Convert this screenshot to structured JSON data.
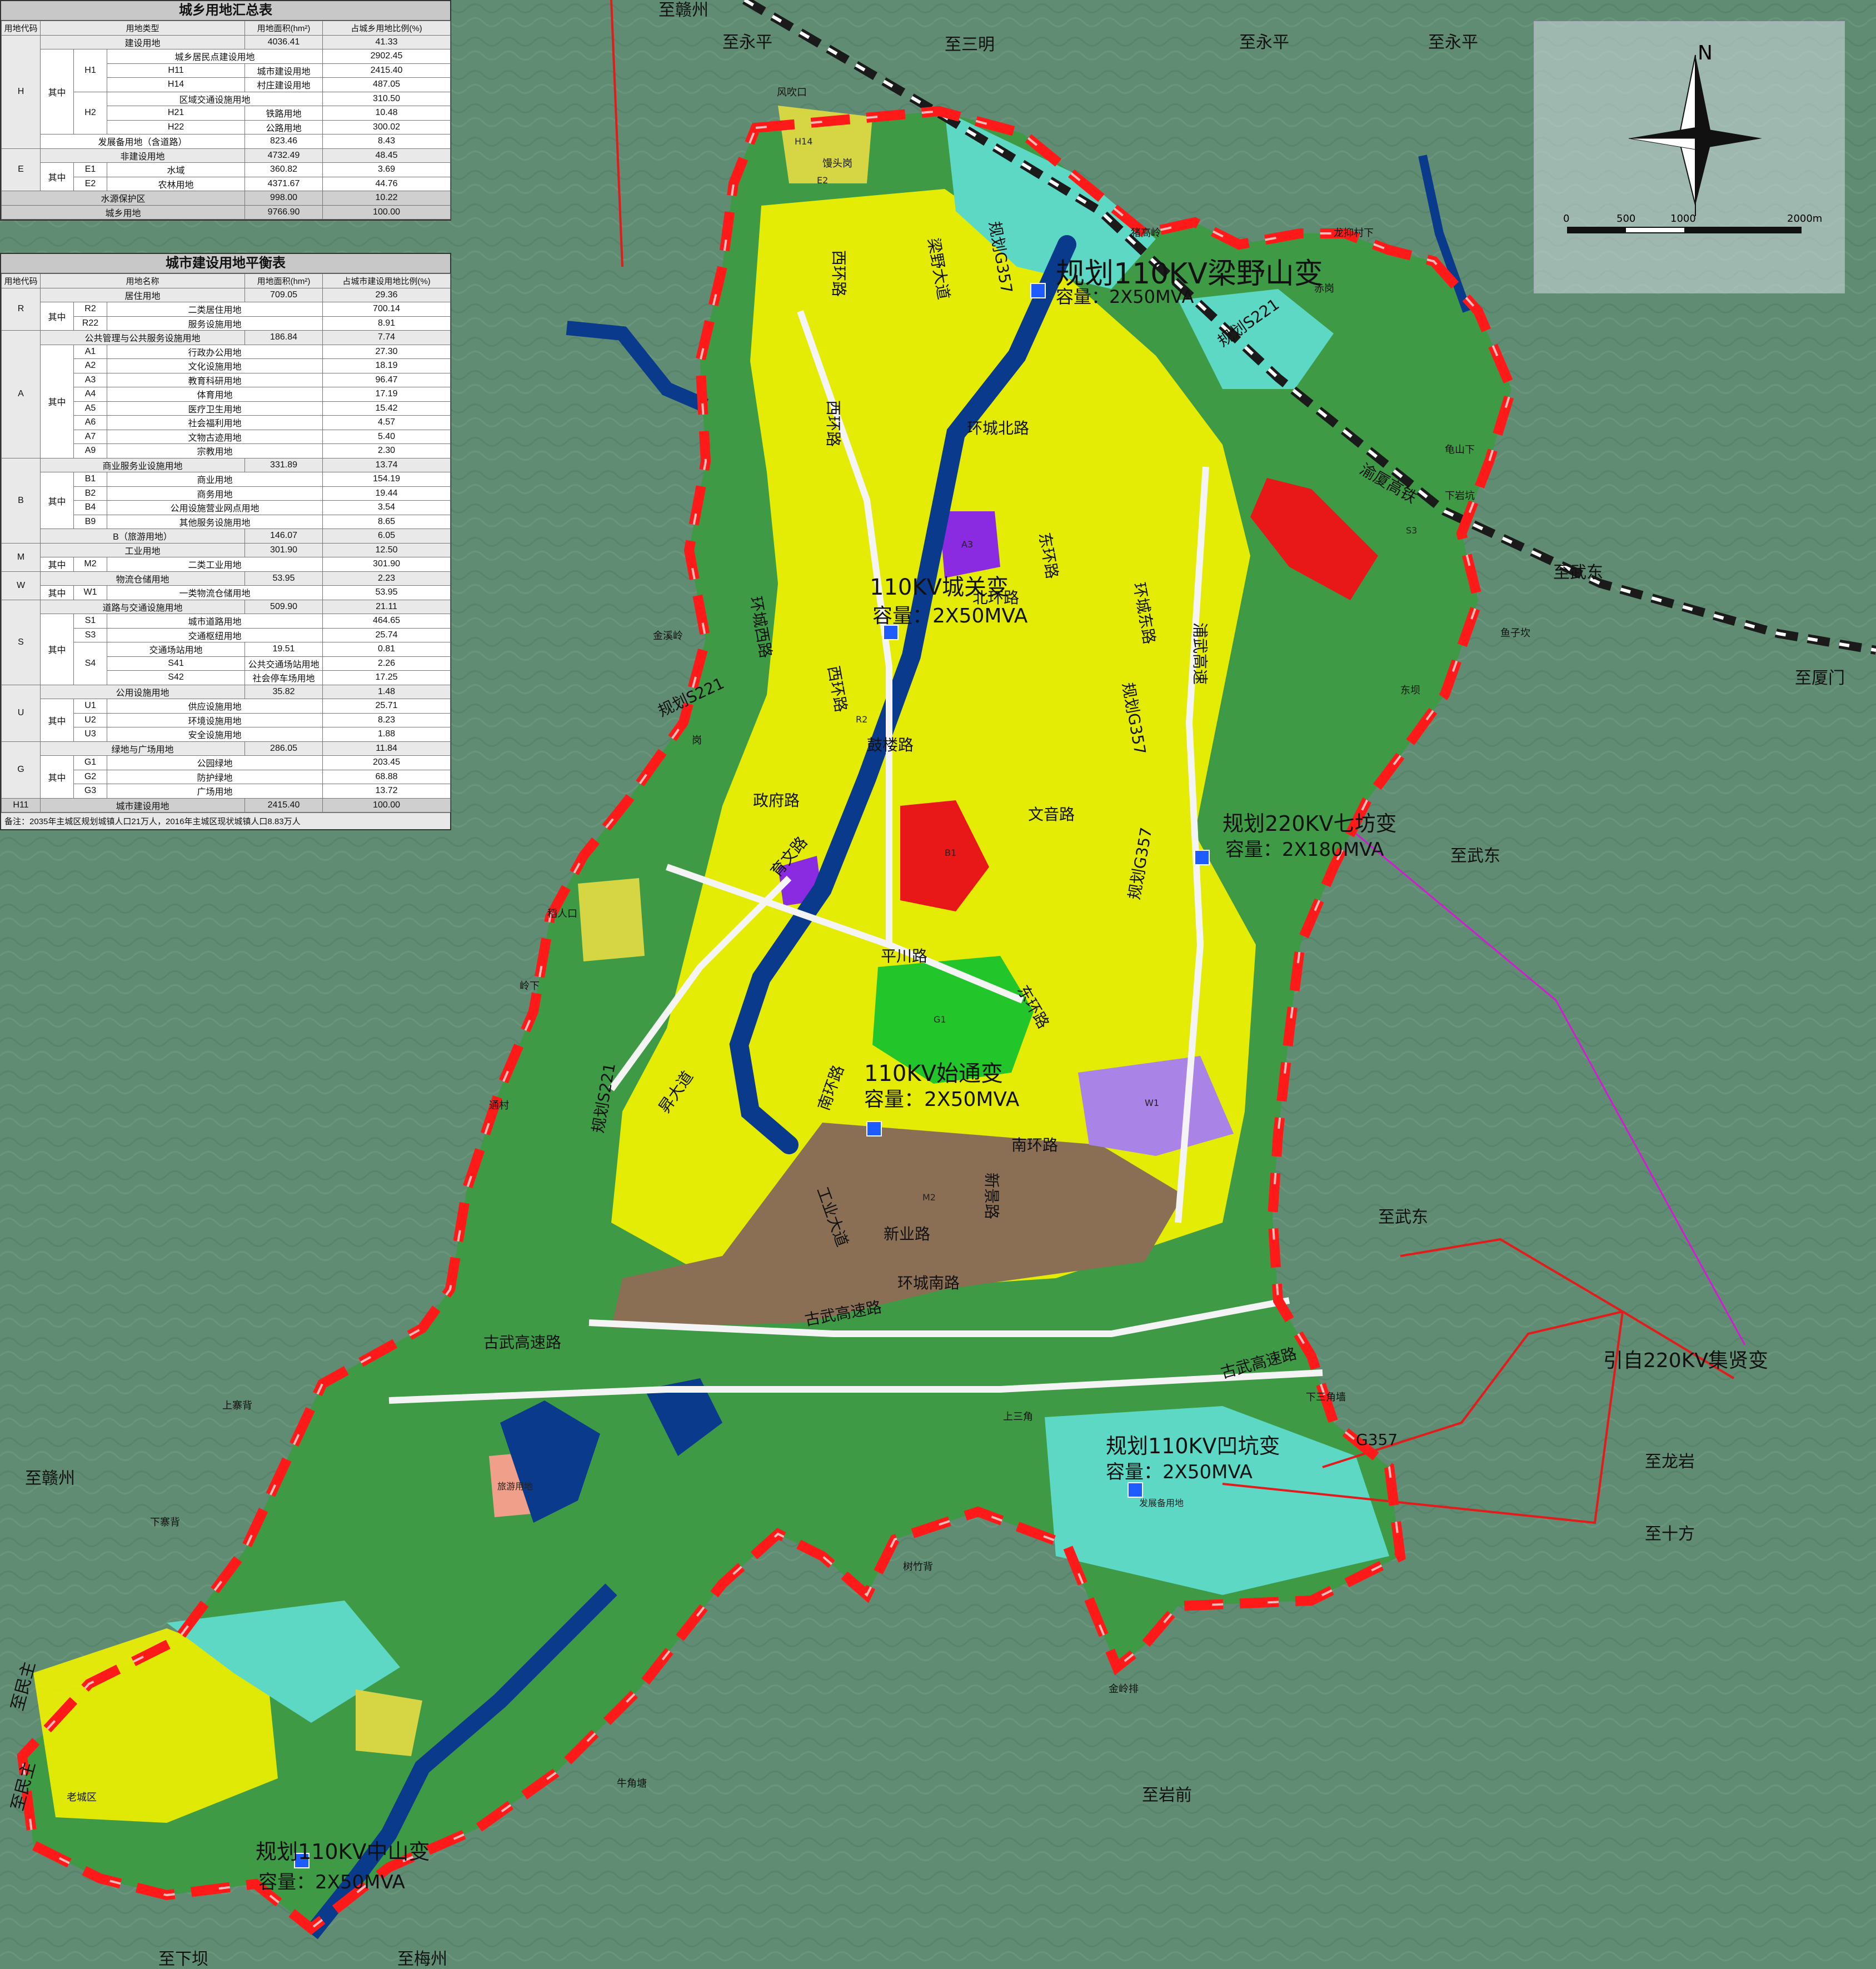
{
  "colors": {
    "mountain": "#5f8c72",
    "green_space": "#3e9a44",
    "park": "#22c52a",
    "residential": "#f2f200",
    "village": "#d6d644",
    "industrial": "#8a6f55",
    "commercial": "#e81818",
    "public": "#8a2be2",
    "reserve": "#5cd8c4",
    "logistics": "#a983e6",
    "tourism": "#f0a08a",
    "water": "#0a3a8c",
    "boundary": "#ff1a1a",
    "rail": "#1a1a1a"
  },
  "table1": {
    "title": "城乡用地汇总表",
    "headers": [
      "用地代码",
      "用地类型",
      "用地面积(hm²)",
      "占城乡用地比例(%)"
    ],
    "rows": [
      [
        "",
        "",
        "建设用地",
        "4036.41",
        "41.33"
      ],
      [
        "H1",
        "",
        "城乡居民点建设用地",
        "2902.45",
        "29.72"
      ],
      [
        "H11",
        "",
        "城市建设用地",
        "2415.40",
        "24.73"
      ],
      [
        "H14",
        "",
        "村庄建设用地",
        "487.05",
        "4.99"
      ],
      [
        "H2",
        "",
        "区域交通设施用地",
        "310.50",
        "3.18"
      ],
      [
        "H21",
        "",
        "铁路用地",
        "10.48",
        "0.11"
      ],
      [
        "H22",
        "",
        "公路用地",
        "300.02",
        "3.07"
      ],
      [
        "",
        "",
        "发展备用地（含道路）",
        "823.46",
        "8.43"
      ],
      [
        "",
        "",
        "非建设用地",
        "4732.49",
        "48.45"
      ],
      [
        "E1",
        "",
        "水域",
        "360.82",
        "3.69"
      ],
      [
        "E2",
        "",
        "农林用地",
        "4371.67",
        "44.76"
      ],
      [
        "",
        "",
        "水源保护区",
        "998.00",
        "10.22"
      ],
      [
        "",
        "",
        "城乡用地",
        "9766.90",
        "100.00"
      ]
    ],
    "group_H": "H",
    "group_E": "E",
    "qizhong": "其中"
  },
  "table2": {
    "title": "城市建设用地平衡表",
    "headers": [
      "用地代码",
      "用地名称",
      "用地面积(hm²)",
      "占城市建设用地比例(%)"
    ],
    "rows": [
      [
        "",
        "居住用地",
        "709.05",
        "29.36"
      ],
      [
        "R2",
        "二类居住用地",
        "700.14",
        "28.99"
      ],
      [
        "R22",
        "服务设施用地",
        "8.91",
        "0.37"
      ],
      [
        "",
        "公共管理与公共服务设施用地",
        "186.84",
        "7.74"
      ],
      [
        "A1",
        "行政办公用地",
        "27.30",
        "1.13"
      ],
      [
        "A2",
        "文化设施用地",
        "18.19",
        "0.75"
      ],
      [
        "A3",
        "教育科研用地",
        "96.47",
        "3.99"
      ],
      [
        "A4",
        "体育用地",
        "17.19",
        "0.71"
      ],
      [
        "A5",
        "医疗卫生用地",
        "15.42",
        "0.64"
      ],
      [
        "A6",
        "社会福利用地",
        "4.57",
        "0.19"
      ],
      [
        "A7",
        "文物古迹用地",
        "5.40",
        "0.22"
      ],
      [
        "A9",
        "宗教用地",
        "2.30",
        "0.10"
      ],
      [
        "",
        "商业服务业设施用地",
        "331.89",
        "13.74"
      ],
      [
        "B1",
        "商业用地",
        "154.19",
        "6.38"
      ],
      [
        "B2",
        "商务用地",
        "19.44",
        "0.80"
      ],
      [
        "B4",
        "公用设施营业网点用地",
        "3.54",
        "0.15"
      ],
      [
        "B9",
        "其他服务设施用地",
        "8.65",
        "0.36"
      ],
      [
        "",
        "B（旅游用地）",
        "146.07",
        "6.05"
      ],
      [
        "",
        "工业用地",
        "301.90",
        "12.50"
      ],
      [
        "M2",
        "二类工业用地",
        "301.90",
        "12.50"
      ],
      [
        "",
        "物流仓储用地",
        "53.95",
        "2.23"
      ],
      [
        "W1",
        "一类物流仓储用地",
        "53.95",
        "2.23"
      ],
      [
        "",
        "道路与交通设施用地",
        "509.90",
        "21.11"
      ],
      [
        "S1",
        "城市道路用地",
        "464.65",
        "19.24"
      ],
      [
        "S3",
        "交通枢纽用地",
        "25.74",
        "1.07"
      ],
      [
        "",
        "交通场站用地",
        "19.51",
        "0.81"
      ],
      [
        "S41",
        "公共交通场站用地",
        "2.26",
        "0.09"
      ],
      [
        "S42",
        "社会停车场用地",
        "17.25",
        "0.71"
      ],
      [
        "",
        "公用设施用地",
        "35.82",
        "1.48"
      ],
      [
        "U1",
        "供应设施用地",
        "25.71",
        "1.06"
      ],
      [
        "U2",
        "环境设施用地",
        "8.23",
        "0.34"
      ],
      [
        "U3",
        "安全设施用地",
        "1.88",
        "0.08"
      ],
      [
        "",
        "绿地与广场用地",
        "286.05",
        "11.84"
      ],
      [
        "G1",
        "公园绿地",
        "203.45",
        "8.42"
      ],
      [
        "G2",
        "防护绿地",
        "68.88",
        "2.85"
      ],
      [
        "G3",
        "广场用地",
        "13.72",
        "0.57"
      ],
      [
        "H11",
        "城市建设用地",
        "2415.40",
        "100.00"
      ]
    ],
    "groups": [
      "R",
      "A",
      "B",
      "M",
      "W",
      "S",
      "U",
      "G"
    ],
    "s4": "S4",
    "qizhong": "其中",
    "note": "备注：2035年主城区规划城镇人口21万人，2016年主城区现状城镇人口8.83万人"
  },
  "compass": {
    "north": "N",
    "scale_labels": [
      "0",
      "500",
      "1000",
      "2000m"
    ]
  },
  "destinations": {
    "ganzhou_n": "至赣州",
    "yongping_1": "至永平",
    "sanming": "至三明",
    "yongping_2": "至永平",
    "yongping_3": "至永平",
    "wudong_1": "至武东",
    "xiamen": "至厦门",
    "wudong_2": "至武东",
    "wudong_3": "至武东",
    "longyan": "至龙岩",
    "shifang": "至十方",
    "ganzhou_w": "至赣州",
    "minzhu_1": "至民主",
    "minzhu_2": "至民主",
    "xiaba": "至下坝",
    "meizhou": "至梅州",
    "yanqian": "至岩前"
  },
  "substations": {
    "liangyeshan": {
      "name": "规划110KV梁野山变",
      "cap": "容量：2X50MVA"
    },
    "chengguan": {
      "name": "110KV城关变",
      "cap": "容量：2X50MVA"
    },
    "qifang": {
      "name": "规划220KV七坊变",
      "cap": "容量：2X180MVA"
    },
    "shitong": {
      "name": "110KV始通变",
      "cap": "容量：2X50MVA"
    },
    "aokeng": {
      "name": "规划110KV凹坑变",
      "cap": "容量：2X50MVA"
    },
    "zhongshan": {
      "name": "规划110KV中山变",
      "cap": "容量：2X50MVA"
    },
    "jixian": "引自220KV集贤变"
  },
  "roads": {
    "liangye": "梁野大道",
    "g357_n": "规划G357",
    "xihuan_1": "西环路",
    "xihuan_2": "西环路",
    "xihuan_3": "西环路",
    "huanchengbei": "环城北路",
    "dong_huan": "东环路",
    "bei_huan": "北环路",
    "huanchengxi": "环城西路",
    "s221_n": "规划S221",
    "s221_ne": "规划S221",
    "s221_w": "规划S221",
    "gulou": "鼓楼路",
    "zhengfu": "政府路",
    "huanchengdong": "环城东路",
    "g357_e": "规划G357",
    "g357_e2": "规划G357",
    "puxian": "浦武高速",
    "wenyin": "文音路",
    "yuwen": "育文路",
    "pingchuan": "平川路",
    "donghuan2": "东环路",
    "nanhuan": "南环路",
    "nanhuan2": "南环路",
    "xinjing": "新景路",
    "xinye": "新业路",
    "gongye": "工业大道",
    "huanchengnan": "环城南路",
    "gucheng": "古武高速路",
    "gucheng2": "古武高速路",
    "gucheng3": "古武高速路",
    "g357_s": "G357",
    "shengda": "昇大道",
    "yuanzhong": "渝厦高铁"
  },
  "places": {
    "fengchuikou": "风吹口",
    "mantouling": "馒头岗",
    "zhutouling": "猪高岭",
    "longgoucun": "龙抑村下",
    "chigang": "赤岗",
    "gangbei": "岗",
    "dongjing": "东坝",
    "jinjing": "金溪岭",
    "guilan": "龟山下",
    "xiaxipo": "下岩坑",
    "xiangu": "鱼子坎",
    "shangshou": "上寨背",
    "xiazhai": "下寨背",
    "laozhai": "老城区",
    "niujiao": "牛角塘",
    "jinling": "金岭排",
    "shupai": "树竹背",
    "xiasan": "下三角墙",
    "tongcun": "通村",
    "xigang": "稻人口",
    "cun1": "岭下",
    "fangshang": "上三角"
  },
  "zones": {
    "e2": "E2",
    "h14": "H14",
    "r2": "R2",
    "m2": "M2",
    "w1": "W1",
    "b1": "B1",
    "a3": "A3",
    "g1": "G1",
    "s3": "S3",
    "reserve": "发展备用地",
    "tour": "旅游用地"
  }
}
